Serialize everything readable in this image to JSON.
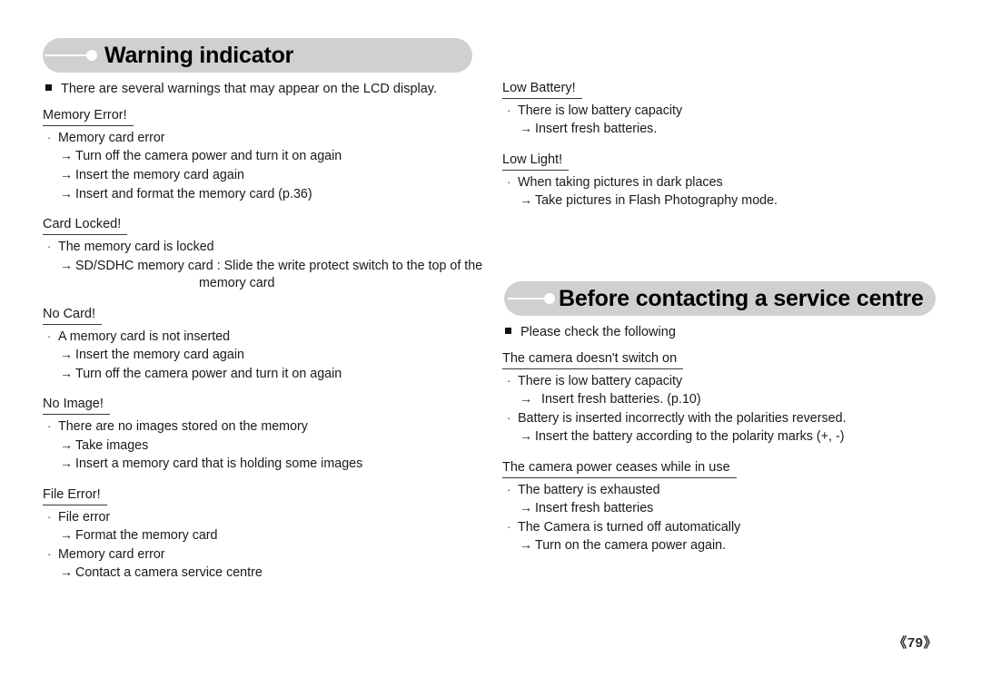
{
  "page": {
    "number_label": "《79》"
  },
  "sections": [
    {
      "banner_title": "Warning indicator",
      "lead": "There are several warnings that may appear on the LCD display.",
      "groups": [
        {
          "title": "Memory Error!",
          "entries": [
            {
              "kind": "item",
              "text": "Memory card error"
            },
            {
              "kind": "sub",
              "text": "Turn off the camera power and turn it on again"
            },
            {
              "kind": "sub",
              "text": "Insert the memory card again"
            },
            {
              "kind": "sub",
              "text": "Insert and format the memory card (p.36)"
            }
          ]
        },
        {
          "title": "Card Locked!",
          "entries": [
            {
              "kind": "item",
              "text": "The memory card is locked"
            },
            {
              "kind": "sub",
              "text": "SD/SDHC memory card : Slide the write protect switch to the top of the"
            },
            {
              "kind": "cont",
              "text": "memory card"
            }
          ]
        },
        {
          "title": "No Card!",
          "entries": [
            {
              "kind": "item",
              "text": "A memory card is not inserted"
            },
            {
              "kind": "sub",
              "text": "Insert the memory card again"
            },
            {
              "kind": "sub",
              "text": "Turn off the camera power and turn it on again"
            }
          ]
        },
        {
          "title": "No Image!",
          "entries": [
            {
              "kind": "item",
              "text": "There are no images stored on the memory"
            },
            {
              "kind": "sub",
              "text": "Take images"
            },
            {
              "kind": "sub",
              "text": "Insert a memory card that is holding some images"
            }
          ]
        },
        {
          "title": "File Error!",
          "entries": [
            {
              "kind": "item",
              "text": "File error"
            },
            {
              "kind": "sub",
              "text": "Format the memory card"
            },
            {
              "kind": "item",
              "text": "Memory card error"
            },
            {
              "kind": "sub",
              "text": "Contact a camera service centre"
            }
          ]
        }
      ]
    },
    {
      "banner_title": "Before contacting a service centre",
      "lead": "Please check the following",
      "groups": [
        {
          "title": "The camera doesn't switch on",
          "entries": [
            {
              "kind": "item",
              "text": "There is low battery capacity"
            },
            {
              "kind": "sub",
              "wide": true,
              "text": "Insert fresh batteries. (p.10)"
            },
            {
              "kind": "item",
              "text": "Battery is inserted incorrectly with the polarities reversed."
            },
            {
              "kind": "sub",
              "text": "Insert the battery according to the polarity marks (+, -)"
            }
          ]
        },
        {
          "title": "The camera power ceases while in use",
          "entries": [
            {
              "kind": "item",
              "text": "The battery is exhausted"
            },
            {
              "kind": "sub",
              "text": "Insert fresh batteries"
            },
            {
              "kind": "item",
              "text": "The Camera is turned off automatically"
            },
            {
              "kind": "sub",
              "text": "Turn on the camera power again."
            }
          ]
        }
      ]
    }
  ],
  "right_column_top_groups": [
    {
      "title": "Low Battery!",
      "entries": [
        {
          "kind": "item",
          "text": "There is low battery capacity"
        },
        {
          "kind": "sub",
          "text": "Insert fresh batteries."
        }
      ]
    },
    {
      "title": "Low Light!",
      "entries": [
        {
          "kind": "item",
          "text": "When taking pictures in dark places"
        },
        {
          "kind": "sub",
          "text": "Take pictures in Flash Photography mode."
        }
      ]
    }
  ],
  "glyphs": {
    "middle_dot": "·",
    "arrow": "→"
  }
}
